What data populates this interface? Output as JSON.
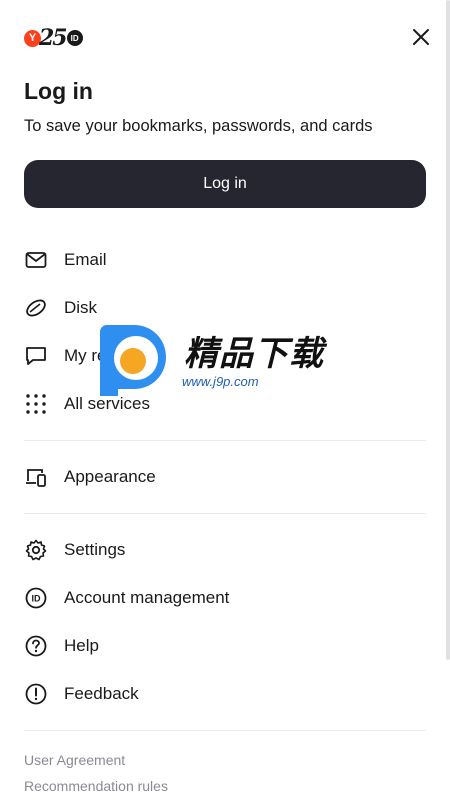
{
  "header": {
    "logo_id_text": "ID",
    "logo_y_text": "Y",
    "logo_number": "25",
    "close_icon": "close-icon"
  },
  "title": "Log in",
  "subtitle": "To save your bookmarks, passwords, and cards",
  "login_button": "Log in",
  "menu": {
    "group1": [
      {
        "label": "Email",
        "icon": "mail-icon"
      },
      {
        "label": "Disk",
        "icon": "disk-icon"
      },
      {
        "label": "My reviews",
        "icon": "chat-icon"
      },
      {
        "label": "All services",
        "icon": "grid-icon"
      }
    ],
    "group2": [
      {
        "label": "Appearance",
        "icon": "devices-icon"
      }
    ],
    "group3": [
      {
        "label": "Settings",
        "icon": "gear-icon"
      },
      {
        "label": "Account management",
        "icon": "id-icon"
      },
      {
        "label": "Help",
        "icon": "help-icon"
      },
      {
        "label": "Feedback",
        "icon": "exclamation-icon"
      }
    ]
  },
  "footer": {
    "user_agreement": "User Agreement",
    "recommendation_rules": "Recommendation rules"
  },
  "watermark": {
    "text": "精品下载",
    "url": "www.j9p.com"
  },
  "colors": {
    "primary_button": "#262630",
    "logo_red": "#fc3f1d",
    "footer_text": "#8a8a94"
  }
}
